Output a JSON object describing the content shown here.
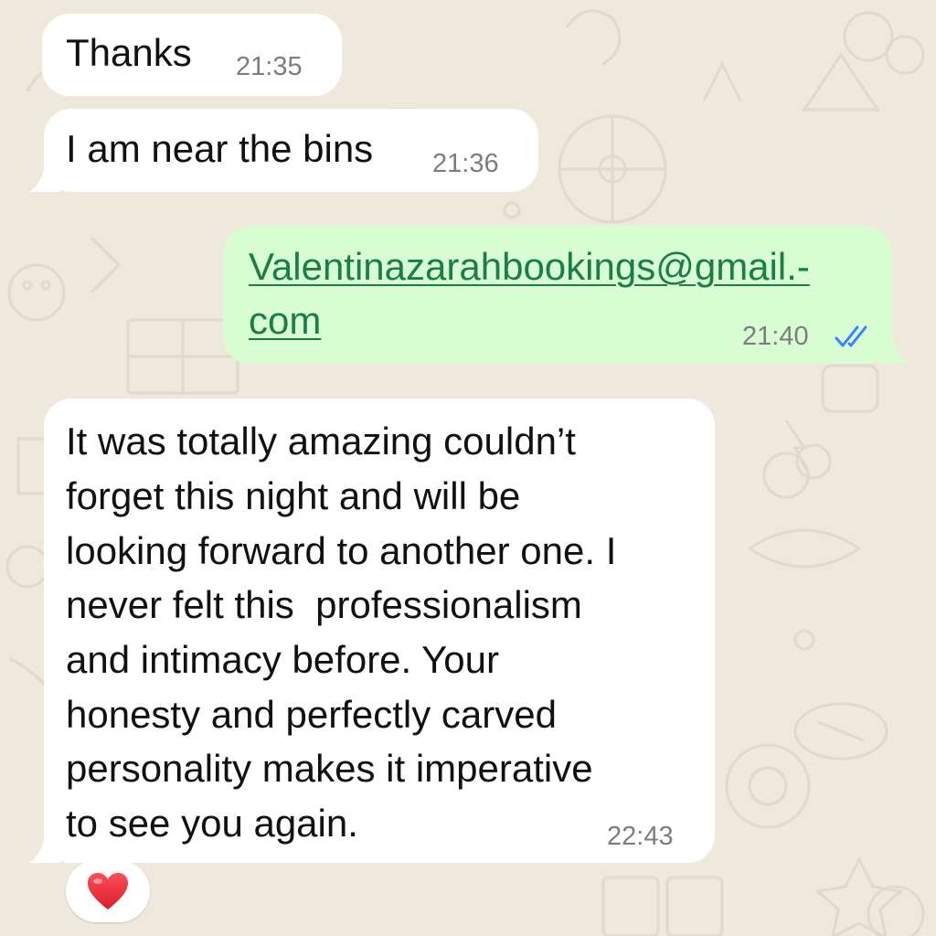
{
  "theme": {
    "wallpaper_color": "#efe8dd",
    "incoming_bubble_color": "#ffffff",
    "outgoing_bubble_color": "#d9fdd3",
    "link_color": "#1a7d4a",
    "read_tick_color": "#3b82f6"
  },
  "messages": [
    {
      "direction": "incoming",
      "text": "Thanks",
      "time": "21:35"
    },
    {
      "direction": "incoming",
      "text": "I am near the bins",
      "time": "21:36"
    },
    {
      "direction": "outgoing",
      "lines": [
        "Valentinazarahbookings@gmail.-",
        "com"
      ],
      "time": "21:40",
      "status_icon": "double-check-read-icon"
    },
    {
      "direction": "incoming",
      "lines": [
        "It was totally amazing couldn’t",
        "forget this night and will be",
        "looking forward to another one. I",
        "never felt this  professionalism",
        "and intimacy before. Your",
        "honesty and perfectly carved",
        "personality makes it imperative",
        "to see you again."
      ],
      "time": "22:43",
      "reaction_icon": "red-heart-icon"
    }
  ]
}
